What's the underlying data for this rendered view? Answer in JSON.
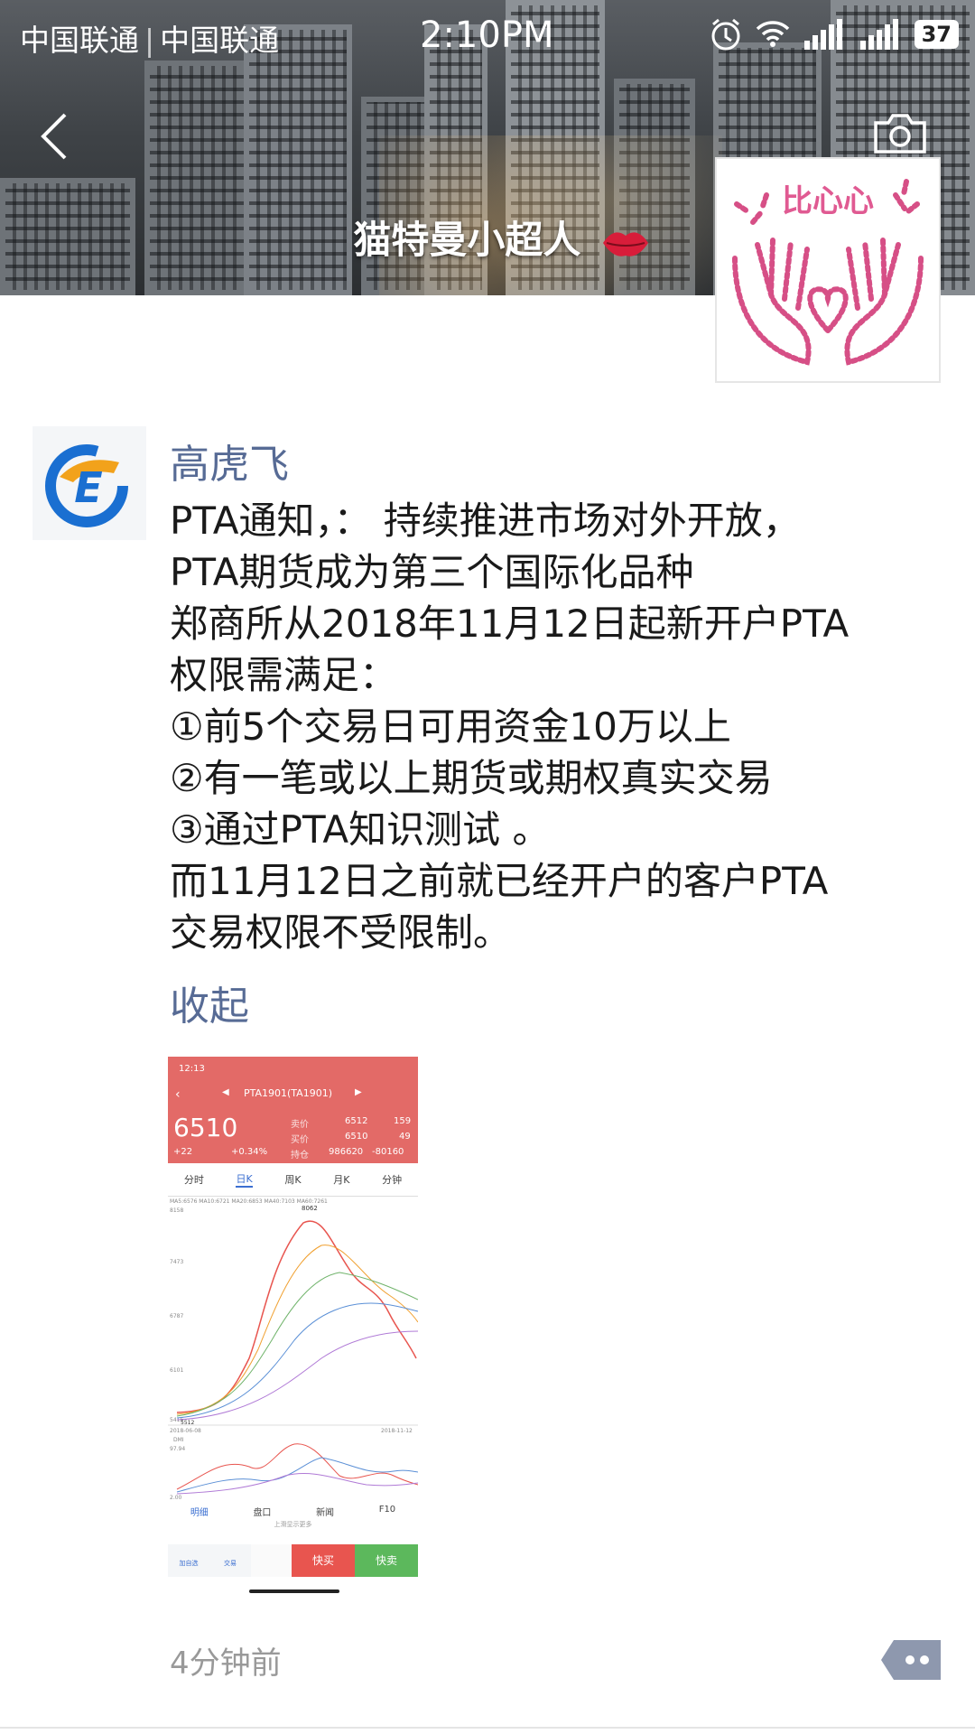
{
  "status_bar": {
    "carrier1": "中国联通",
    "carrier2": "中国联通",
    "time": "2:10PM",
    "battery": "37"
  },
  "cover": {
    "nickname": "猫特曼小超人"
  },
  "post": {
    "author": "高虎飞",
    "lines": [
      "PTA通知，：  持续推进市场对外开放，",
      "PTA期货成为第三个国际化品种",
      "郑商所从2018年11月12日起新开户PTA",
      "权限需满足：",
      "①前5个交易日可用资金10万以上",
      "②有一笔或以上期货或期权真实交易",
      "③通过PTA知识测试 。",
      "而11月12日之前就已经开户的客户PTA",
      "交易权限不受限制。"
    ],
    "collapse_label": "收起",
    "time": "4分钟前"
  },
  "screenshot": {
    "status_time": "12:13",
    "title": "PTA1901(TA1901)",
    "price": "6510",
    "change": "+22",
    "change_pct": "+0.34%",
    "sell_label": "卖价",
    "sell_price": "6512",
    "sell_vol": "159",
    "buy_label": "买价",
    "buy_price": "6510",
    "buy_vol": "49",
    "hold_label": "持仓",
    "hold_value": "986620",
    "hold_change": "-80160",
    "tabs": [
      "分时",
      "日K",
      "周K",
      "月K",
      "分钟"
    ],
    "ma_text": "MA5:6576  MA10:6721  MA20:6853  MA40:7103  MA60:7261",
    "high_label": "8062",
    "y_ticks": [
      "8158",
      "7473",
      "6787",
      "6101",
      "5416"
    ],
    "low_label": "5512",
    "date_start": "2018-06-08",
    "date_end": "2018-11-12",
    "dmi_label": "DMI",
    "dmi_ticks": [
      "97.94",
      "2.00"
    ],
    "bottom_tabs": [
      "明细",
      "盘口",
      "新闻",
      "F10"
    ],
    "hint": "上滑显示更多",
    "btn1": "加自选",
    "btn2": "交易",
    "buy_btn": "快买",
    "sell_btn": "快卖"
  }
}
